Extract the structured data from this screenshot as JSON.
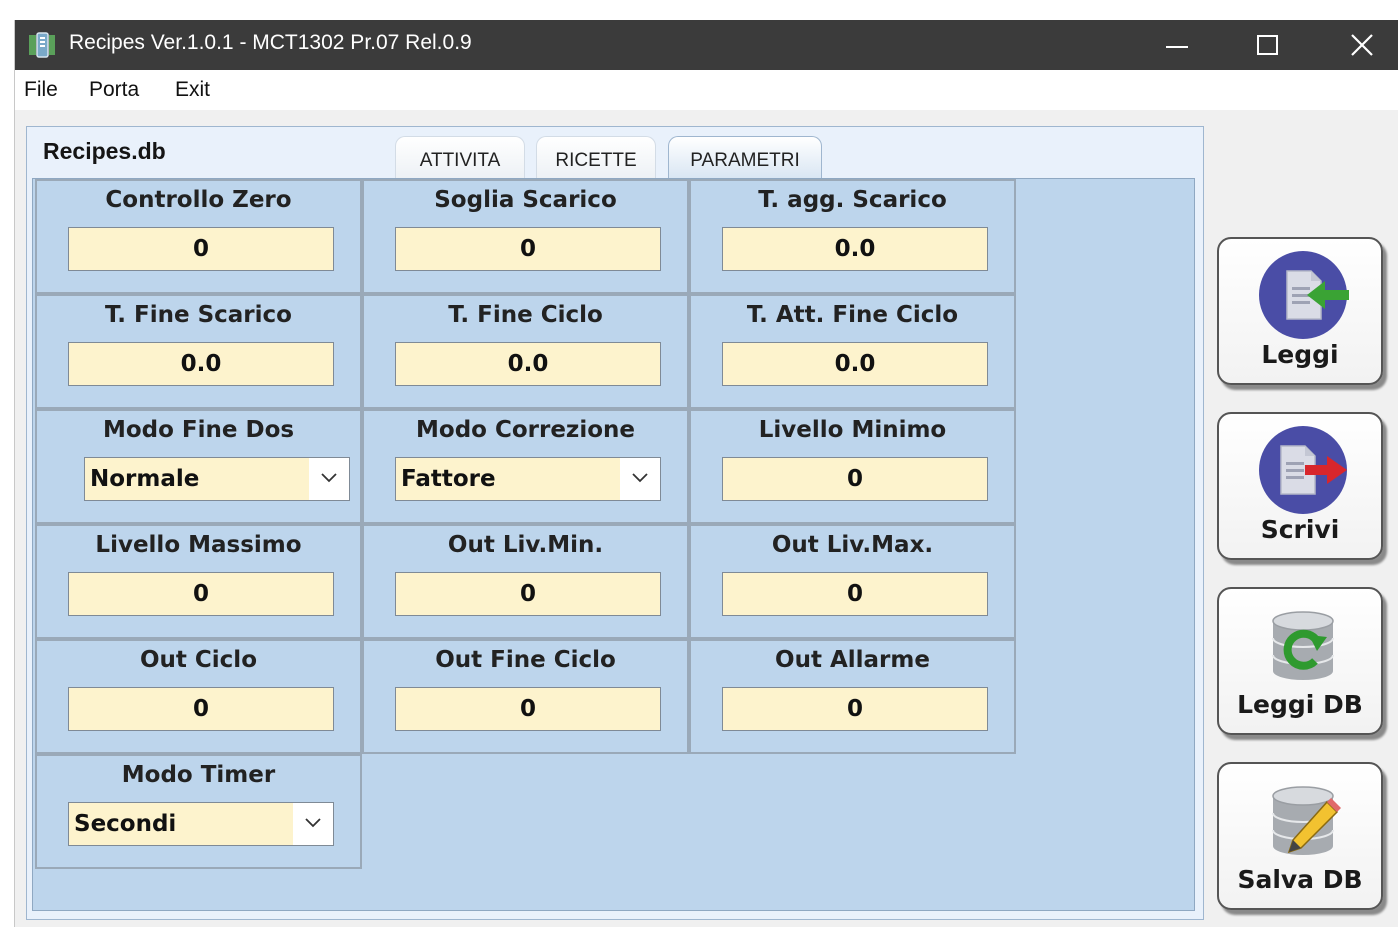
{
  "window": {
    "title": "Recipes Ver.1.0.1 - MCT1302 Pr.07 Rel.0.9",
    "controls": [
      "minimize-icon",
      "maximize-icon",
      "close-icon"
    ]
  },
  "menu": {
    "file": "File",
    "porta": "Porta",
    "exit": "Exit"
  },
  "db_name": "Recipes.db",
  "tabs": {
    "attivita": "ATTIVITA",
    "ricette": "RICETTE",
    "parametri": "PARAMETRI",
    "active": "PARAMETRI"
  },
  "params": {
    "controllo_zero": {
      "label": "Controllo Zero",
      "value": "0"
    },
    "soglia_scarico": {
      "label": "Soglia Scarico",
      "value": "0"
    },
    "t_agg_scarico": {
      "label": "T. agg. Scarico",
      "value": "0.0"
    },
    "t_fine_scarico": {
      "label": "T. Fine Scarico",
      "value": "0.0"
    },
    "t_fine_ciclo": {
      "label": "T. Fine Ciclo",
      "value": "0.0"
    },
    "t_att_fine_ciclo": {
      "label": "T. Att. Fine Ciclo",
      "value": "0.0"
    },
    "modo_fine_dos": {
      "label": "Modo Fine Dos",
      "value": "Normale"
    },
    "modo_correzione": {
      "label": "Modo Correzione",
      "value": "Fattore"
    },
    "livello_minimo": {
      "label": "Livello Minimo",
      "value": "0"
    },
    "livello_massimo": {
      "label": "Livello Massimo",
      "value": "0"
    },
    "out_liv_min": {
      "label": "Out Liv.Min.",
      "value": "0"
    },
    "out_liv_max": {
      "label": "Out Liv.Max.",
      "value": "0"
    },
    "out_ciclo": {
      "label": "Out Ciclo",
      "value": "0"
    },
    "out_fine_ciclo": {
      "label": "Out Fine Ciclo",
      "value": "0"
    },
    "out_allarme": {
      "label": "Out Allarme",
      "value": "0"
    },
    "modo_timer": {
      "label": "Modo Timer",
      "value": "Secondi"
    }
  },
  "buttons": {
    "leggi": {
      "label": "Leggi",
      "icon": "document-import-icon"
    },
    "scrivi": {
      "label": "Scrivi",
      "icon": "document-export-icon"
    },
    "leggi_db": {
      "label": "Leggi DB",
      "icon": "database-refresh-icon"
    },
    "salva_db": {
      "label": "Salva DB",
      "icon": "database-save-icon"
    }
  },
  "colors": {
    "titlebar": "#3b3b3b",
    "panel": "#bdd5ec",
    "field": "#fdf3cd",
    "icon_circle": "#4a4da6",
    "arrow_green": "#3aa334",
    "arrow_red": "#d8262c"
  }
}
